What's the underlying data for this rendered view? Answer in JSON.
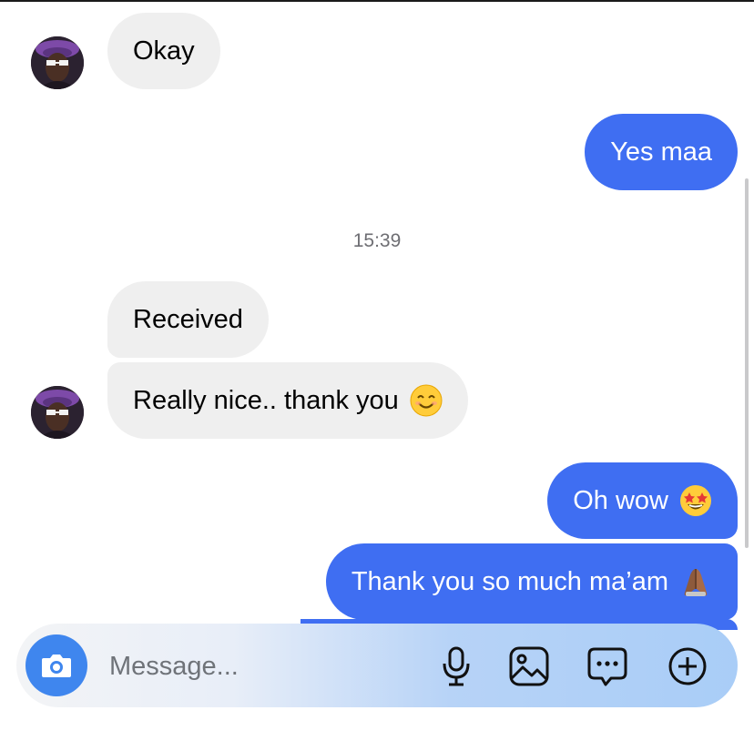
{
  "messages": [
    {
      "direction": "incoming",
      "text": "Okay"
    },
    {
      "direction": "outgoing",
      "text": "Yes maa"
    },
    {
      "direction": "incoming",
      "text": "Received"
    },
    {
      "direction": "incoming",
      "text": "Really nice.. thank you",
      "emoji": "smiling-face-icon"
    },
    {
      "direction": "outgoing",
      "text": "Oh wow",
      "emoji": "star-struck-face-icon"
    },
    {
      "direction": "outgoing",
      "text": "Thank you so much ma’am",
      "emoji": "folded-hands-icon"
    }
  ],
  "timestamp": "15:39",
  "composer": {
    "placeholder": "Message...",
    "value": "",
    "icons": [
      "camera-icon",
      "microphone-icon",
      "gallery-icon",
      "sticker-icon",
      "add-icon"
    ]
  },
  "colors": {
    "outgoing_bubble": "#3f6ef2",
    "incoming_bubble": "#efefef",
    "camera_button": "#3f86ee"
  }
}
